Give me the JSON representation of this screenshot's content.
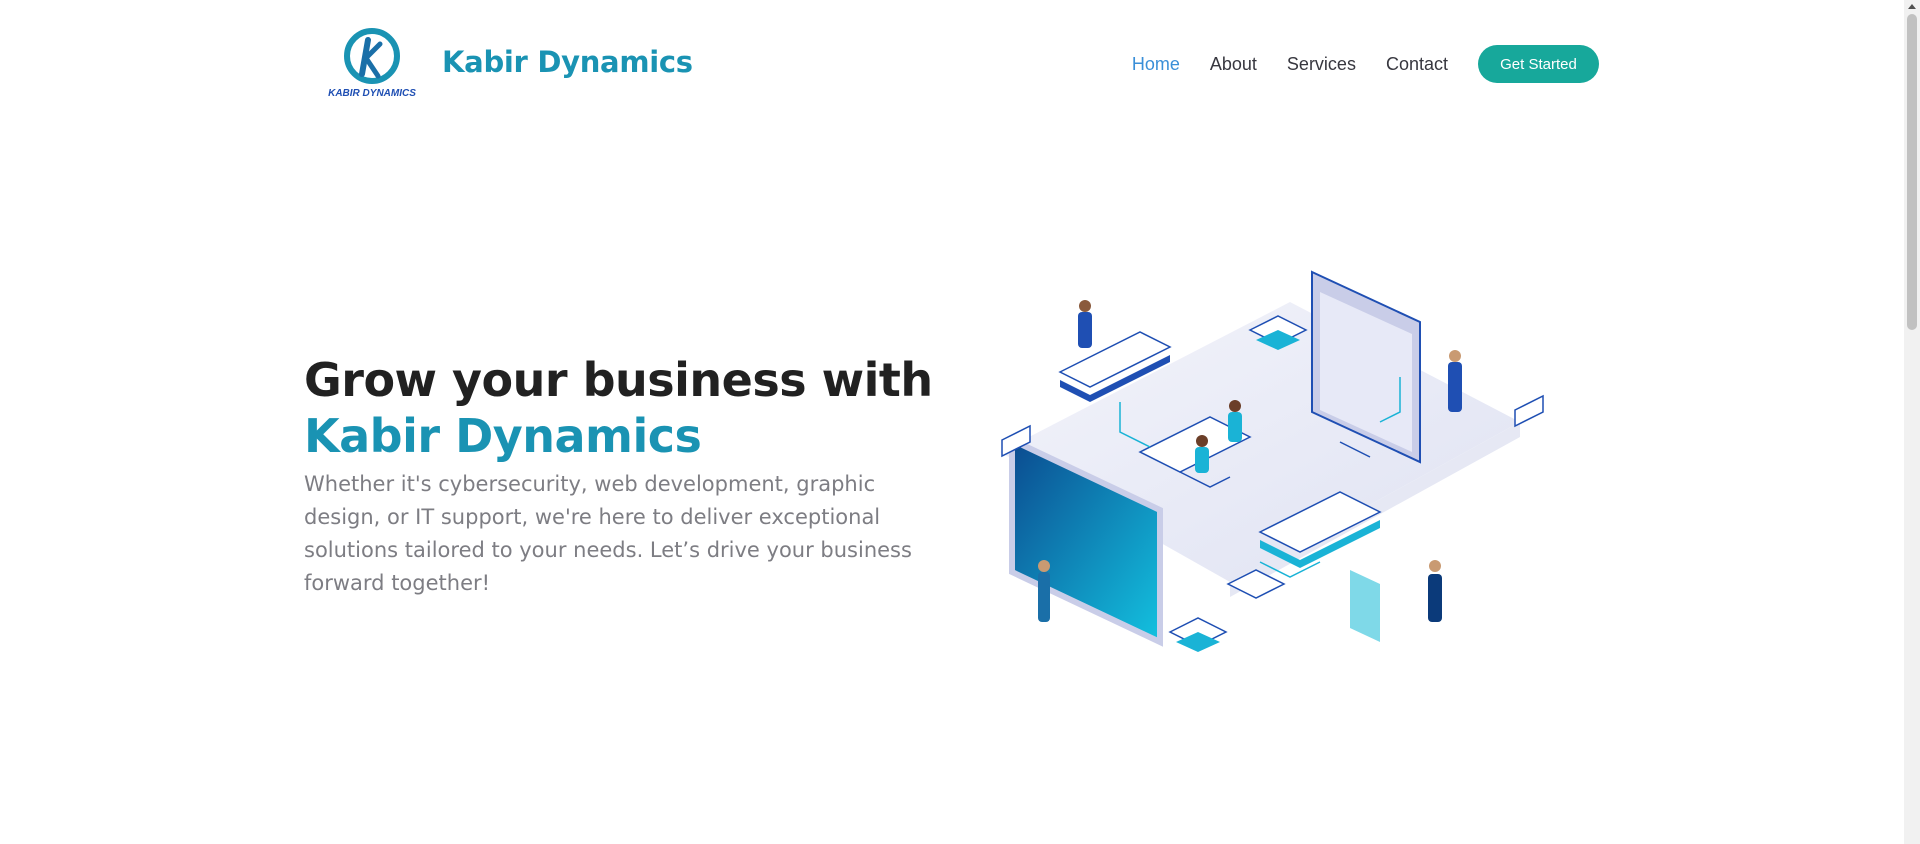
{
  "header": {
    "logo_text": "KABIR DYNAMICS",
    "brand": "Kabir Dynamics",
    "nav": [
      {
        "label": "Home",
        "active": true
      },
      {
        "label": "About",
        "active": false
      },
      {
        "label": "Services",
        "active": false
      },
      {
        "label": "Contact",
        "active": false
      }
    ],
    "cta_label": "Get Started"
  },
  "hero": {
    "title_line1": "Grow your business with",
    "title_line2": "Kabir Dynamics",
    "subtitle": "Whether it's cybersecurity, web development, graphic design, or IT support, we're here to deliver exceptional solutions tailored to your needs. Let’s drive your business forward together!"
  },
  "colors": {
    "brand": "#1a93b3",
    "nav_active": "#3a8fd8",
    "cta_bg": "#17a89b",
    "heading": "#212121",
    "body_text": "#7d7d83"
  }
}
